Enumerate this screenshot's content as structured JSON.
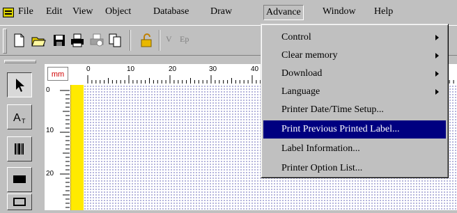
{
  "menubar": {
    "items": [
      "File",
      "Edit",
      "View",
      "Object",
      "Database",
      "Draw",
      "Advance",
      "Window",
      "Help"
    ],
    "active": "Advance"
  },
  "toolbar": {
    "buttons": [
      "new-icon",
      "open-icon",
      "save-icon",
      "print-icon",
      "print-preview-icon",
      "copy-icon",
      "lock-icon",
      "v-icon",
      "ep-icon"
    ],
    "partial_labels": [
      "V",
      "Ep"
    ]
  },
  "tools": [
    "select-arrow-icon",
    "text-tool-icon",
    "barcode-tool-icon",
    "filled-rect-icon",
    "rect-tool-icon"
  ],
  "ruler": {
    "unit": "mm",
    "h_labels": [
      "0",
      "10",
      "20",
      "30",
      "40"
    ],
    "v_labels": [
      "0",
      "10",
      "20"
    ]
  },
  "dropdown": {
    "items": [
      {
        "label": "Control",
        "submenu": true
      },
      {
        "label": "Clear memory",
        "submenu": true
      },
      {
        "label": "Download",
        "submenu": true
      },
      {
        "label": "Language",
        "submenu": true
      },
      {
        "label": "Printer Date/Time Setup...",
        "submenu": false
      },
      {
        "label": "Print Previous Printed Label...",
        "submenu": false,
        "highlighted": true
      },
      {
        "label": "Label Information...",
        "submenu": false
      },
      {
        "label": "Printer Option List...",
        "submenu": false
      }
    ]
  },
  "colors": {
    "highlight": "#000080",
    "ruler_unit": "#d00000",
    "margin_bar": "#ffea00",
    "dot_grid": "#9c9cd0"
  }
}
